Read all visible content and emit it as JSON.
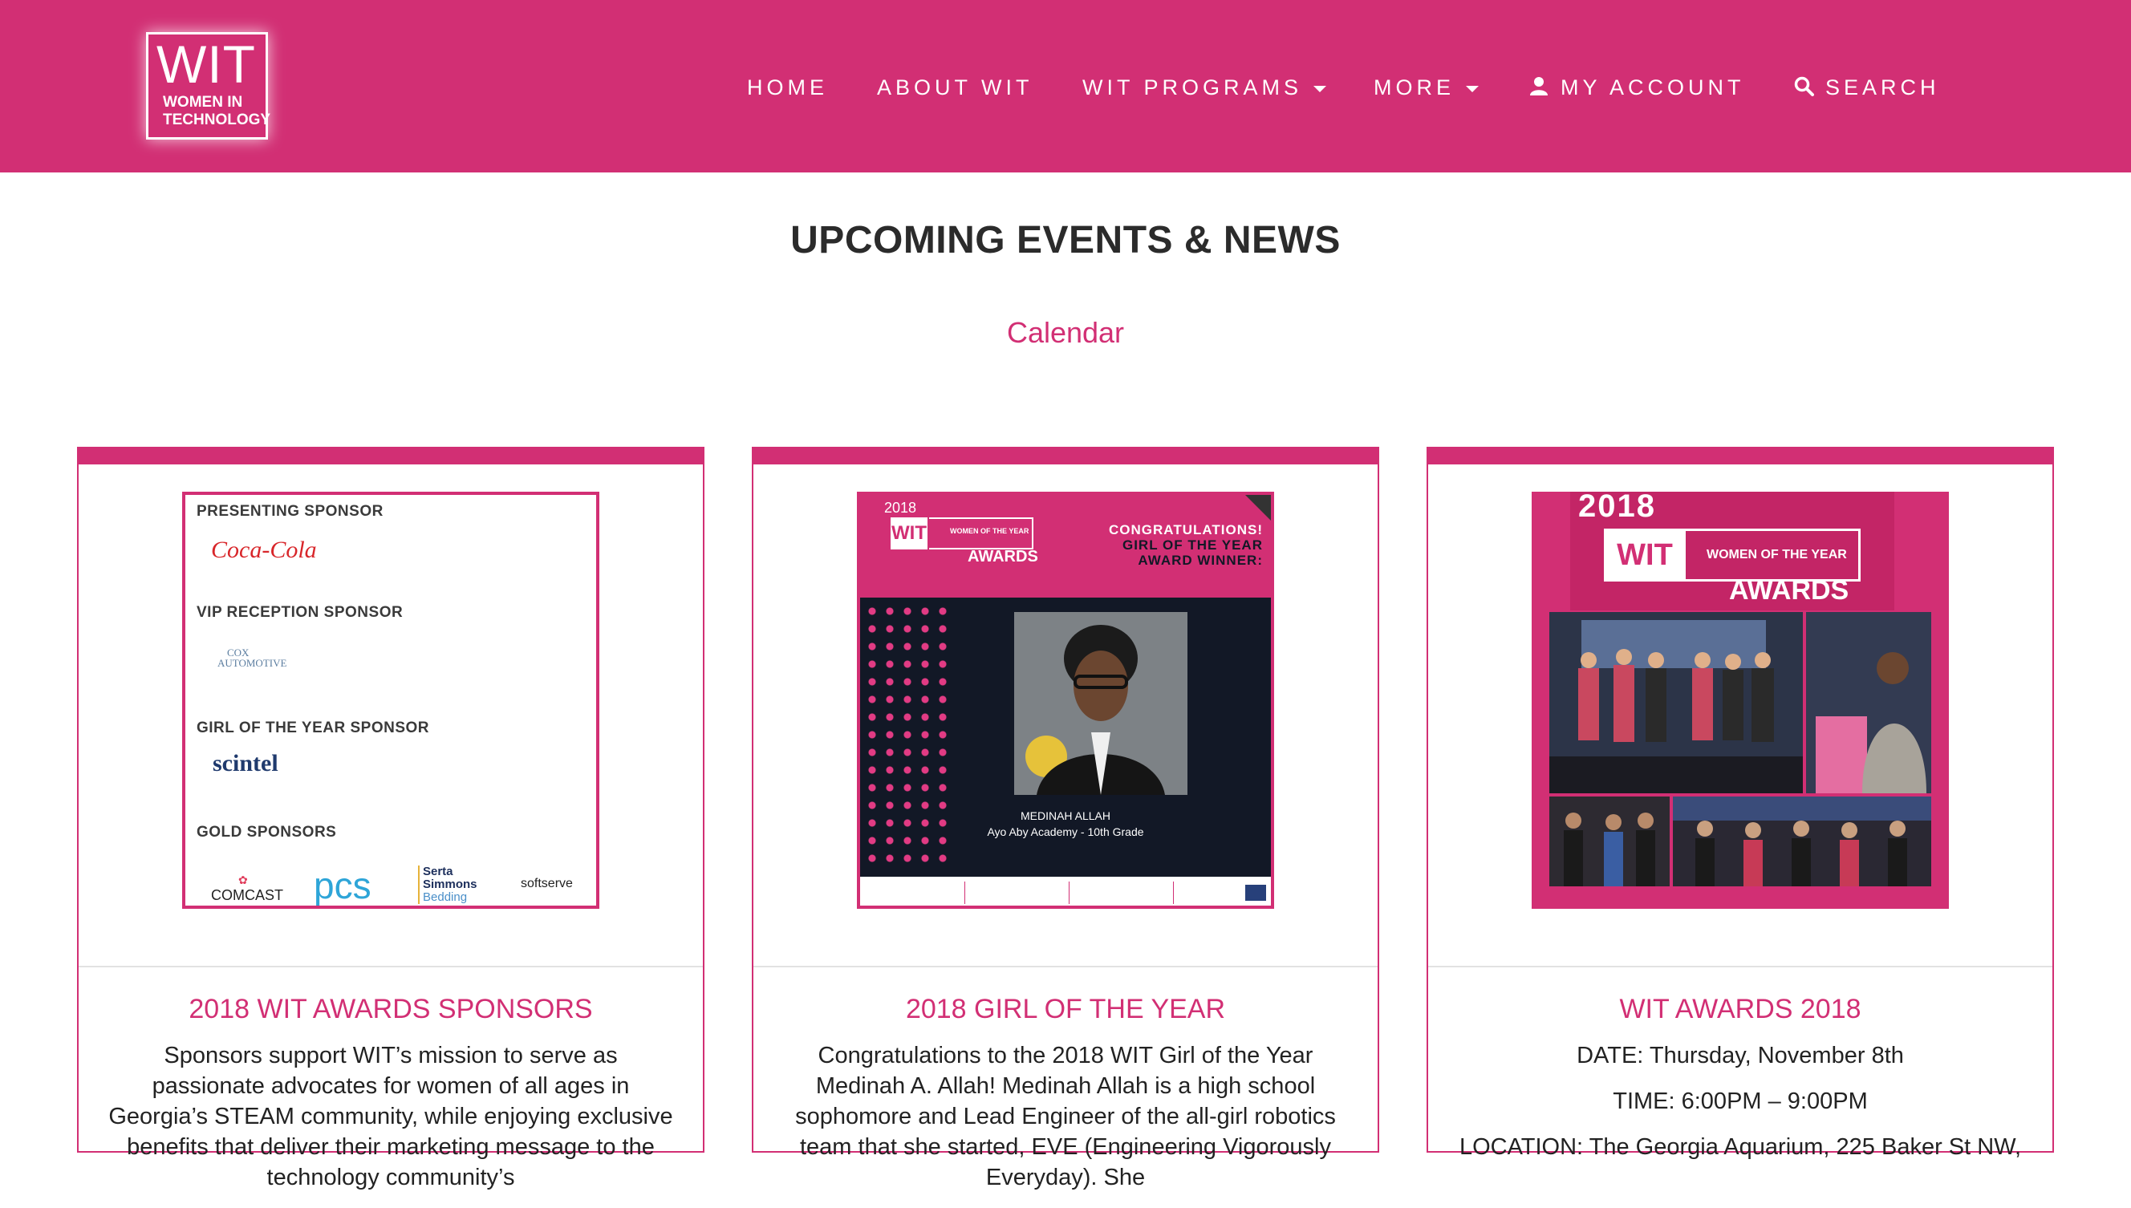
{
  "header": {
    "logo": {
      "big": "WIT",
      "line1": "WOMEN IN",
      "line2": "TECHNOLOGY"
    },
    "nav": [
      {
        "label": "HOME"
      },
      {
        "label": "ABOUT WIT"
      },
      {
        "label": "WIT PROGRAMS"
      },
      {
        "label": "MORE"
      },
      {
        "label": "MY ACCOUNT",
        "icon": "user-icon"
      },
      {
        "label": "SEARCH",
        "icon": "search-icon"
      }
    ]
  },
  "main": {
    "title": "UPCOMING EVENTS & NEWS",
    "calendar_link": "Calendar"
  },
  "cards": [
    {
      "title": "2018 WIT AWARDS SPONSORS",
      "body": [
        "Sponsors support WIT’s mission to serve as passionate advocates for women of all ages in Georgia’s STEAM community, while enjoying exclusive benefits that deliver their marketing message to the technology community’s"
      ],
      "image": {
        "labels": [
          "PRESENTING SPONSOR",
          "VIP RECEPTION SPONSOR",
          "GIRL OF THE YEAR SPONSOR",
          "GOLD SPONSORS"
        ],
        "logos": {
          "coca": "Coca-Cola",
          "cox1": "COX",
          "cox2": "AUTOMOTIVE",
          "scintel": "scintel",
          "comcast": "COMCAST",
          "pcs": "pcs",
          "serta1": "Serta",
          "serta2": "Simmons",
          "serta3": "Bedding",
          "softserve": "softserve"
        }
      }
    },
    {
      "title": "2018 GIRL OF THE YEAR",
      "body": [
        "Congratulations to the 2018 WIT Girl of the Year Medinah A. Allah! Medinah Allah is a high school sophomore and Lead Engineer of the all-girl robotics team that she started, EVE (Engineering Vigorously Everyday). She"
      ],
      "image": {
        "year": "2018",
        "wit": "WIT",
        "woty": "WOMEN OF THE YEAR",
        "awards": "AWARDS",
        "congrats": [
          "CONGRATULATIONS!",
          "GIRL OF THE YEAR",
          "AWARD WINNER:"
        ],
        "name": "MEDINAH ALLAH",
        "school": "Ayo Aby Academy - 10th Grade"
      }
    },
    {
      "title": "WIT AWARDS 2018",
      "body": [
        "DATE: Thursday, November 8th",
        "TIME: 6:00PM – 9:00PM",
        "LOCATION: The Georgia Aquarium, 225 Baker St NW,"
      ],
      "image": {
        "year": "2018",
        "wit": "WIT",
        "woty": "WOMEN OF THE YEAR",
        "awards": "AWARDS"
      }
    }
  ],
  "colors": {
    "brand": "#d22f74",
    "dark": "#121826"
  }
}
